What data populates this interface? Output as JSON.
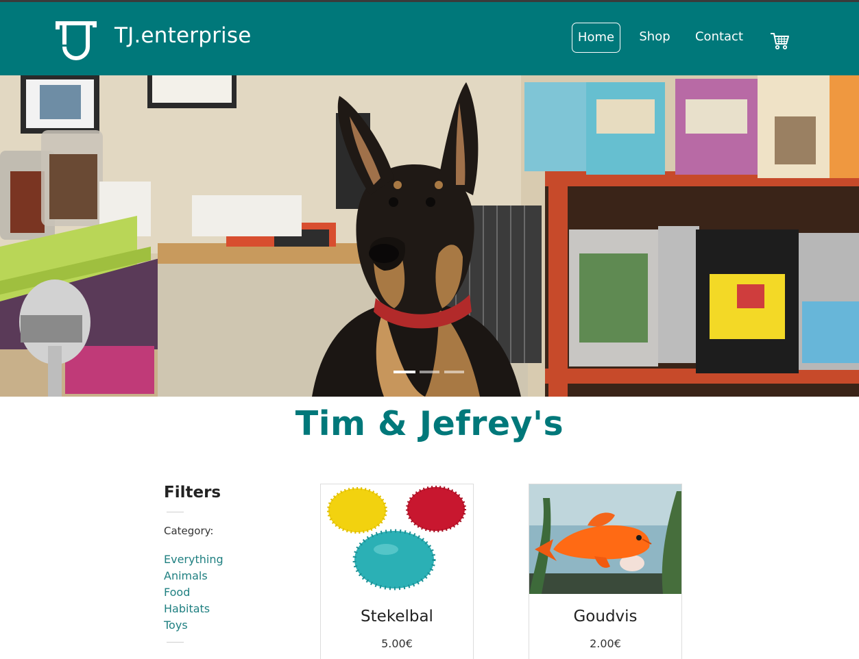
{
  "header": {
    "brand": "TJ.enterprise",
    "logo_icon": "tj-logo-icon",
    "nav": [
      {
        "label": "Home",
        "active": true
      },
      {
        "label": "Shop",
        "active": false
      },
      {
        "label": "Contact",
        "active": false
      }
    ],
    "cart_icon": "shopping-cart-icon"
  },
  "hero": {
    "slides": 3,
    "active_slide": 1
  },
  "main": {
    "title": "Tim & Jefrey's"
  },
  "filters": {
    "title": "Filters",
    "category_label": "Category:",
    "categories": [
      "Everything",
      "Animals",
      "Food",
      "Habitats",
      "Toys"
    ]
  },
  "products": [
    {
      "name": "Stekelbal",
      "price": "5.00€"
    },
    {
      "name": "Goudvis",
      "price": "2.00€"
    }
  ],
  "colors": {
    "accent": "#00787a",
    "filter_link": "#1e7f80"
  }
}
